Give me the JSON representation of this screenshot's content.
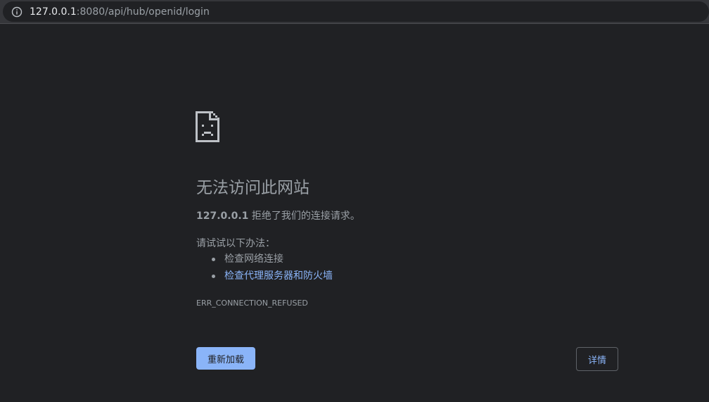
{
  "address_bar": {
    "host": "127.0.0.1",
    "rest": ":8080/api/hub/openid/login",
    "icon": "info-icon"
  },
  "error_page": {
    "icon": "sad-document-icon",
    "title": "无法访问此网站",
    "host": "127.0.0.1",
    "message": " 拒绝了我们的连接请求。",
    "suggestions_heading": "请试试以下办法：",
    "suggestions": [
      {
        "label": "检查网络连接"
      },
      {
        "label": "检查代理服务器和防火墙"
      }
    ],
    "error_code": "ERR_CONNECTION_REFUSED",
    "reload_label": "重新加载",
    "details_label": "详情"
  },
  "colors": {
    "background": "#202124",
    "text": "#9aa0a6",
    "link": "#8ab4f8",
    "button": "#8ab4f8"
  }
}
